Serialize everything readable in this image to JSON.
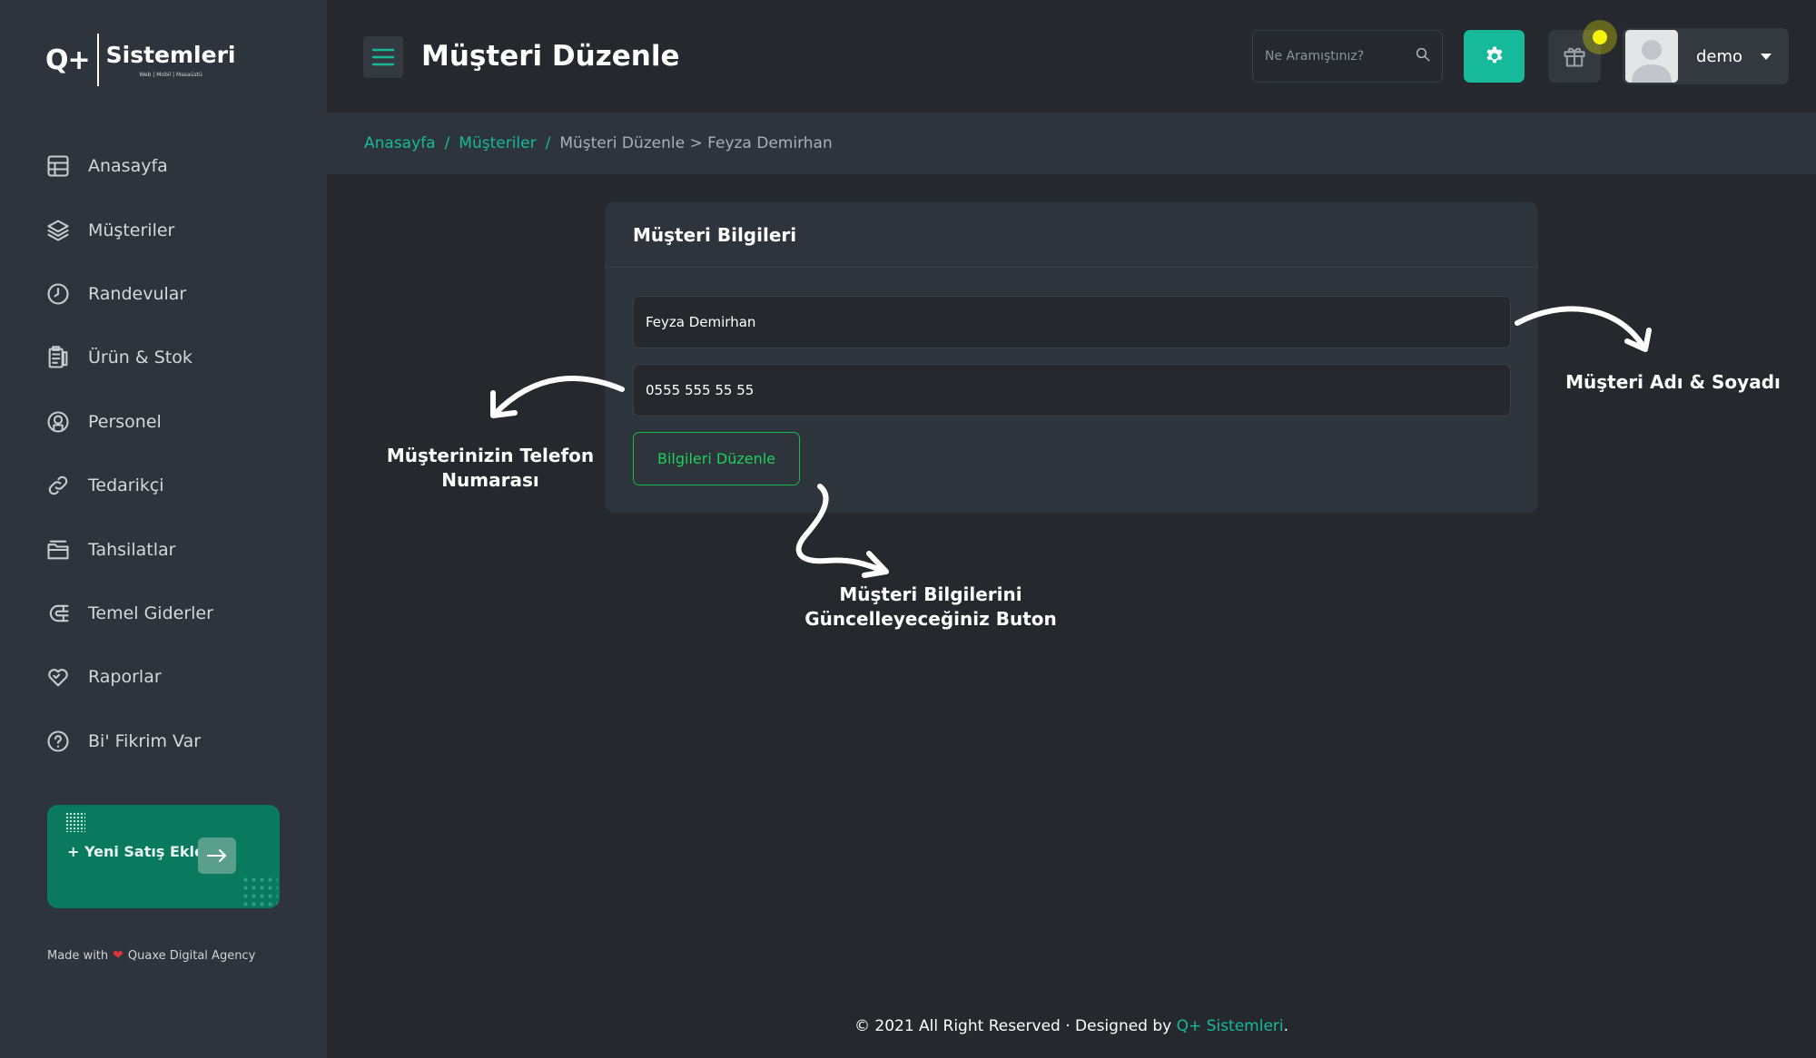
{
  "brand": {
    "mark": "Q+",
    "name": "Sistemleri",
    "tagline": "Web | Mobil | Masaüstü"
  },
  "sidebar": {
    "items": [
      {
        "label": "Anasayfa",
        "icon": "dashboard-icon"
      },
      {
        "label": "Müşteriler",
        "icon": "layers-icon"
      },
      {
        "label": "Randevular",
        "icon": "clock-icon"
      },
      {
        "label": "Ürün & Stok",
        "icon": "clipboard-icon"
      },
      {
        "label": "Personel",
        "icon": "user-circle-icon"
      },
      {
        "label": "Tedarikçi",
        "icon": "link-icon"
      },
      {
        "label": "Tahsilatlar",
        "icon": "folder-icon"
      },
      {
        "label": "Temel Giderler",
        "icon": "magnet-icon"
      },
      {
        "label": "Raporlar",
        "icon": "heart-icon"
      },
      {
        "label": "Bi' Fikrim Var",
        "icon": "help-icon"
      }
    ],
    "promo_label": "+ Yeni Satış Ekle",
    "made_with_prefix": "Made with",
    "made_with_suffix": "Quaxe Digital Agency"
  },
  "header": {
    "title": "Müşteri Düzenle",
    "search_placeholder": "Ne Aramıştınız?",
    "username": "demo",
    "accent_color": "#17b99b",
    "notification_color": "#f5f20e"
  },
  "breadcrumb": {
    "home": "Anasayfa",
    "section": "Müşteriler",
    "separator": "/",
    "current": "Müşteri Düzenle > Feyza Demirhan"
  },
  "card": {
    "title": "Müşteri Bilgileri",
    "name_value": "Feyza Demirhan",
    "phone_value": "0555 555 55 55",
    "button_label": "Bilgileri Düzenle"
  },
  "annotations": {
    "name_label": "Müşteri Adı & Soyadı",
    "phone_label_line1": "Müşterinizin Telefon",
    "phone_label_line2": "Numarası",
    "button_label_line1": "Müşteri Bilgilerini",
    "button_label_line2": "Güncelleyeceğiniz Buton"
  },
  "footer": {
    "text": "© 2021 All Right Reserved · Designed by",
    "link": "Q+ Sistemleri",
    "end": "."
  }
}
